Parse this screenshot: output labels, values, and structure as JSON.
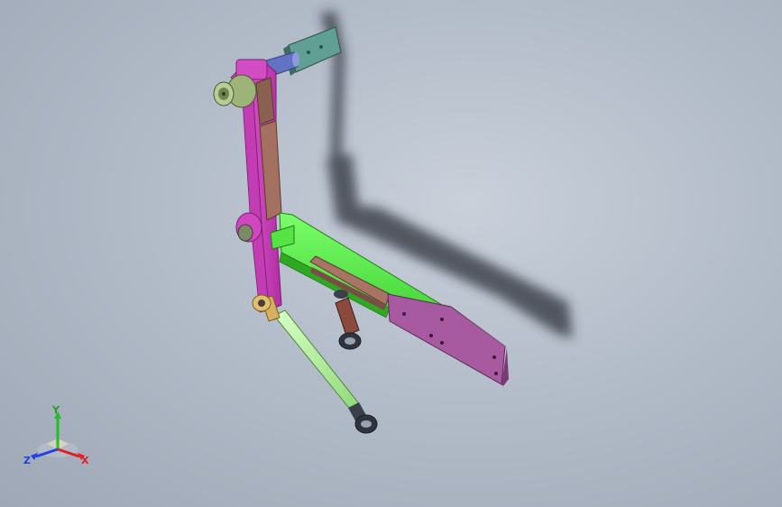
{
  "viewport": {
    "background_top": "#c9d0da",
    "background_bottom": "#9ea8b6"
  },
  "colors": {
    "magenta_arm": "#d946c8",
    "green_arm": "#5af04a",
    "purple_plate": "#a05596",
    "brown_plate": "#9a6a5a",
    "blue_rod": "#5a6ab8",
    "teal_bracket": "#4f8a80",
    "olive_motor": "#8ea56a",
    "light_green_rod": "#b8f0a0",
    "shadow": "#333840"
  },
  "triad": {
    "x_label": "X",
    "y_label": "Y",
    "z_label": "Z",
    "x_color": "#e02020",
    "y_color": "#20c020",
    "z_color": "#2040e0"
  }
}
